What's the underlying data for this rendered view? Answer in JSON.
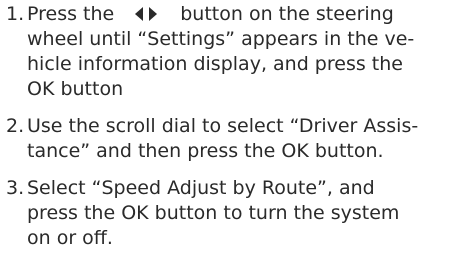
{
  "steps": [
    {
      "number": "1.",
      "line1_before": "Press the",
      "button_icon": "left-right-arrow-icon",
      "line1_after": "button on the steering",
      "line2": "wheel until “Settings” appears in the ve-",
      "line3": "hicle information display, and press the",
      "line4": "OK button"
    },
    {
      "number": "2.",
      "line1": "Use the scroll dial to select “Driver Assis-",
      "line2": "tance” and then press the OK button."
    },
    {
      "number": "3.",
      "line1": "Select “Speed Adjust by Route”, and",
      "line2": "press the OK button to turn the system",
      "line3": "on or off."
    }
  ]
}
